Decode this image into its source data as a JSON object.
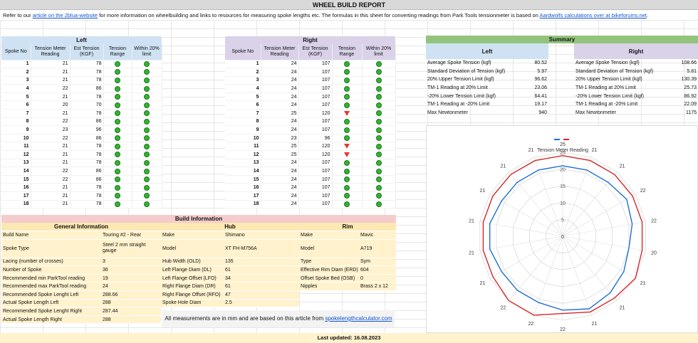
{
  "title": "WHEEL BUILD REPORT",
  "intro": {
    "pre": "Refer to our ",
    "link1": "article on the 2blua-website",
    "mid": " for more information on wheelbuilding and links to resources for measuring spoke lengths etc. The formulas in this sheet for converting readings from Park Tools tensionmeter is based on ",
    "link2": "Aardwolfs calculations over at bikeforums.net",
    "post": "."
  },
  "left": {
    "title": "Left",
    "headers": [
      "Spoke No",
      "Tension Meter Reading",
      "Est Tension (KGF)",
      "Tension Range",
      "Within 20% limit"
    ],
    "rows": [
      [
        1,
        21,
        78,
        "ok"
      ],
      [
        2,
        21,
        78,
        "ok"
      ],
      [
        3,
        21,
        78,
        "ok"
      ],
      [
        4,
        22,
        86,
        "ok"
      ],
      [
        5,
        21,
        78,
        "ok"
      ],
      [
        6,
        20,
        70,
        "ok"
      ],
      [
        7,
        21,
        78,
        "ok"
      ],
      [
        8,
        22,
        86,
        "ok"
      ],
      [
        9,
        23,
        96,
        "ok"
      ],
      [
        10,
        22,
        86,
        "ok"
      ],
      [
        11,
        21,
        78,
        "ok"
      ],
      [
        12,
        21,
        78,
        "ok"
      ],
      [
        13,
        21,
        78,
        "ok"
      ],
      [
        14,
        22,
        86,
        "ok"
      ],
      [
        15,
        22,
        86,
        "ok"
      ],
      [
        16,
        21,
        78,
        "ok"
      ],
      [
        17,
        21,
        78,
        "ok"
      ],
      [
        18,
        21,
        78,
        "ok"
      ]
    ]
  },
  "right": {
    "title": "Right",
    "headers": [
      "Spoke No",
      "Tension Meter Reading",
      "Est Tension (KGF)",
      "Tension Range",
      "Within 20% limit"
    ],
    "rows": [
      [
        1,
        24,
        107,
        "ok"
      ],
      [
        2,
        24,
        107,
        "ok"
      ],
      [
        3,
        24,
        107,
        "ok"
      ],
      [
        4,
        24,
        107,
        "ok"
      ],
      [
        5,
        24,
        107,
        "ok"
      ],
      [
        6,
        24,
        107,
        "ok"
      ],
      [
        7,
        25,
        120,
        "high"
      ],
      [
        8,
        24,
        107,
        "ok"
      ],
      [
        9,
        24,
        107,
        "ok"
      ],
      [
        10,
        23,
        96,
        "ok"
      ],
      [
        11,
        25,
        120,
        "high"
      ],
      [
        12,
        25,
        120,
        "high"
      ],
      [
        13,
        24,
        107,
        "ok"
      ],
      [
        14,
        24,
        107,
        "ok"
      ],
      [
        15,
        24,
        107,
        "ok"
      ],
      [
        16,
        24,
        107,
        "ok"
      ],
      [
        17,
        24,
        107,
        "ok"
      ],
      [
        18,
        24,
        107,
        "ok"
      ]
    ]
  },
  "summary": {
    "title": "Summary",
    "left": "Left",
    "right": "Right",
    "rows": [
      [
        "Average Spoke Tension (kgf)",
        "80.52",
        "108.66"
      ],
      [
        "Standard Deviation of Tension (kgf)",
        "5.97",
        "5.81"
      ],
      [
        "20% Upper Tension Limit (kgf)",
        "96.62",
        "130.39"
      ],
      [
        "TM-1 Reading at 20% Limit",
        "23.06",
        "25.73"
      ],
      [
        "-20% Lower Tension Limit (kgf)",
        "64.41",
        "86.92"
      ],
      [
        "TM-1 Reading at -20% Limit",
        "19.17",
        "22.09"
      ],
      [
        "Max Newtonmeter",
        "940",
        "1175"
      ]
    ]
  },
  "chart_data": {
    "type": "radar",
    "title": "Tension Meter Reading",
    "categories": [
      "1",
      "2",
      "3",
      "4",
      "5",
      "6",
      "7",
      "8",
      "9",
      "10",
      "11",
      "12",
      "13",
      "14",
      "15",
      "16",
      "17",
      "18"
    ],
    "radial_ticks": [
      "0",
      "5",
      "10",
      "15",
      "20",
      "25"
    ],
    "rmax": 25,
    "series": [
      {
        "color": "#1f6fd6",
        "values": [
          21,
          21,
          21,
          22,
          21,
          20,
          21,
          22,
          23,
          22,
          21,
          21,
          21,
          22,
          22,
          21,
          21,
          21
        ]
      },
      {
        "color": "#d62728",
        "values": [
          24,
          24,
          24,
          24,
          24,
          24,
          25,
          24,
          24,
          23,
          25,
          25,
          24,
          24,
          24,
          24,
          24,
          24
        ]
      }
    ],
    "outer_labels": [
      "25",
      "21",
      "21",
      "22",
      "22",
      "20",
      "21",
      "21",
      "21",
      "22",
      "22",
      "22",
      "21",
      "21",
      "21",
      "21",
      "21",
      "21"
    ]
  },
  "build": {
    "title": "Build Information",
    "general": {
      "title": "General Information",
      "rows": [
        [
          "Build Name",
          "Touring #2 - Rear"
        ],
        [
          "Spoke Type",
          "Steel 2 mm straight gauge"
        ],
        [
          "Lacing (number of crosses)",
          "3"
        ],
        [
          "Number of Spoke",
          "36"
        ],
        [
          "Recommended min ParkTool reading",
          "19"
        ],
        [
          "Recommended max ParkTool reading",
          "24"
        ],
        [
          "Recommended Spoke Lenght Left",
          "288.66"
        ],
        [
          "Actual Spoke Length Left",
          "288"
        ],
        [
          "Recommended Spoke Lenght Right",
          "287.44"
        ],
        [
          "Actual Spoke Length Right",
          "288"
        ]
      ]
    },
    "hub": {
      "title": "Hub",
      "rows": [
        [
          "Make",
          "Shimano"
        ],
        [
          "Model",
          "XT FH-M756A"
        ],
        [
          "Hub Width (OLD)",
          "135"
        ],
        [
          "Left Flange Diam (DL)",
          "61"
        ],
        [
          "Left Flange Offset (LFO)",
          "34"
        ],
        [
          "Right Flange Diam (DR)",
          "61"
        ],
        [
          "Right Flange Offset (RFO)",
          "47"
        ],
        [
          "Spoke Hole Diam",
          "2.5"
        ]
      ]
    },
    "rim": {
      "title": "Rim",
      "rows": [
        [
          "Make",
          "Mavic"
        ],
        [
          "Model",
          "A719"
        ],
        [
          "Type",
          "Sym"
        ],
        [
          "Effective Rim Diam (ERD)",
          "604"
        ],
        [
          "Offset Spoke Bed (OSB)",
          "0"
        ],
        [
          "Nipples",
          "Brass 2 x 12"
        ]
      ]
    }
  },
  "note": {
    "pre": "All measurements are in mm and are based on this article from ",
    "link": "spokelengthcalculator.com"
  },
  "footer": "Last updated: 16.08.2023"
}
